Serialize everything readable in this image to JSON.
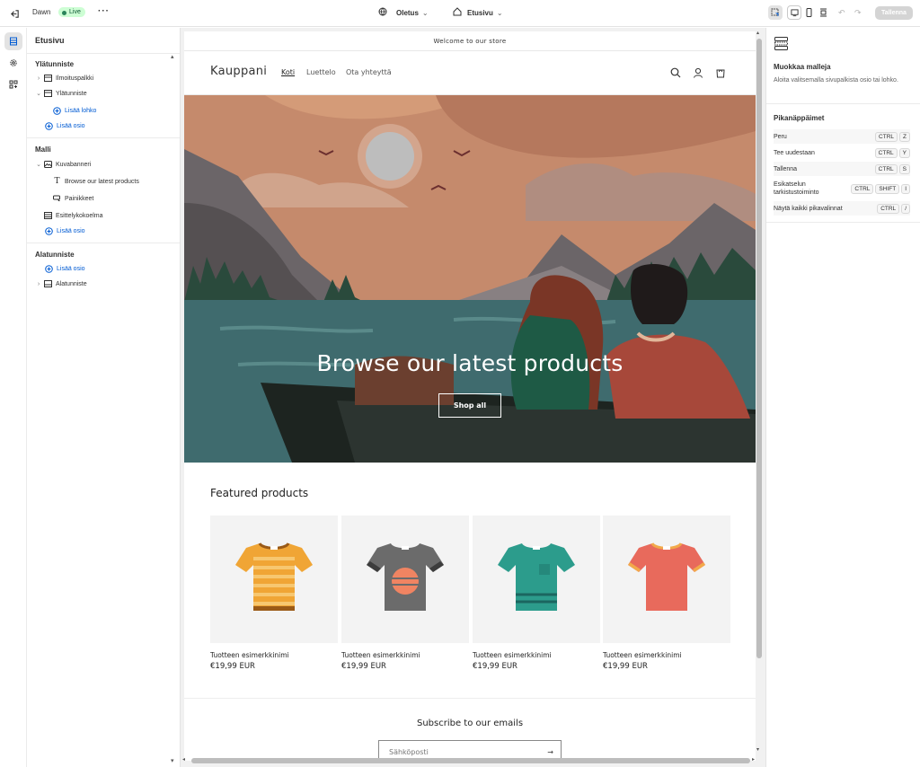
{
  "topbar": {
    "theme_name": "Dawn",
    "live_label": "Live",
    "template_label": "Oletus",
    "page_label": "Etusivu",
    "save_label": "Tallenna"
  },
  "sidebar": {
    "title": "Etusivu",
    "header_section": "Ylätunniste",
    "header_items": [
      {
        "label": "Ilmoituspalkki"
      },
      {
        "label": "Ylätunniste"
      }
    ],
    "add_block": "Lisää lohko",
    "add_section": "Lisää osio",
    "template_section": "Malli",
    "template_items": [
      {
        "label": "Kuvabanneri"
      },
      {
        "label": "Browse our latest products"
      },
      {
        "label": "Painikkeet"
      },
      {
        "label": "Esittelykokoelma"
      }
    ],
    "footer_section": "Alatunniste",
    "footer_items": [
      {
        "label": "Alatunniste"
      }
    ]
  },
  "store": {
    "announcement": "Welcome to our store",
    "logo": "Kauppani",
    "nav": [
      "Koti",
      "Luettelo",
      "Ota yhteyttä"
    ],
    "banner_heading": "Browse our latest products",
    "banner_button": "Shop all",
    "featured_title": "Featured products",
    "products": [
      {
        "name": "Tuotteen esimerkkinimi",
        "price": "€19,99 EUR"
      },
      {
        "name": "Tuotteen esimerkkinimi",
        "price": "€19,99 EUR"
      },
      {
        "name": "Tuotteen esimerkkinimi",
        "price": "€19,99 EUR"
      },
      {
        "name": "Tuotteen esimerkkinimi",
        "price": "€19,99 EUR"
      }
    ],
    "subscribe_title": "Subscribe to our emails",
    "email_placeholder": "Sähköposti"
  },
  "right_panel": {
    "title": "Muokkaa malleja",
    "description": "Aloita valitsemalla sivupalkista osio tai lohko.",
    "shortcuts_title": "Pikanäppäimet",
    "shortcuts": [
      {
        "label": "Peru",
        "keys": [
          "CTRL",
          "Z"
        ]
      },
      {
        "label": "Tee uudestaan",
        "keys": [
          "CTRL",
          "Y"
        ]
      },
      {
        "label": "Tallenna",
        "keys": [
          "CTRL",
          "S"
        ]
      },
      {
        "label": "Esikatselun tarkistustoiminto",
        "keys": [
          "CTRL",
          "SHIFT",
          "I"
        ]
      },
      {
        "label": "Näytä kaikki pikavalinnat",
        "keys": [
          "CTRL",
          "/"
        ]
      }
    ]
  },
  "colors": {
    "accent": "#005bd3",
    "live_bg": "#cdfed4",
    "live_dot": "#29845a",
    "banner_sky": "#c58a6c",
    "banner_water": "#3f6b6e"
  }
}
